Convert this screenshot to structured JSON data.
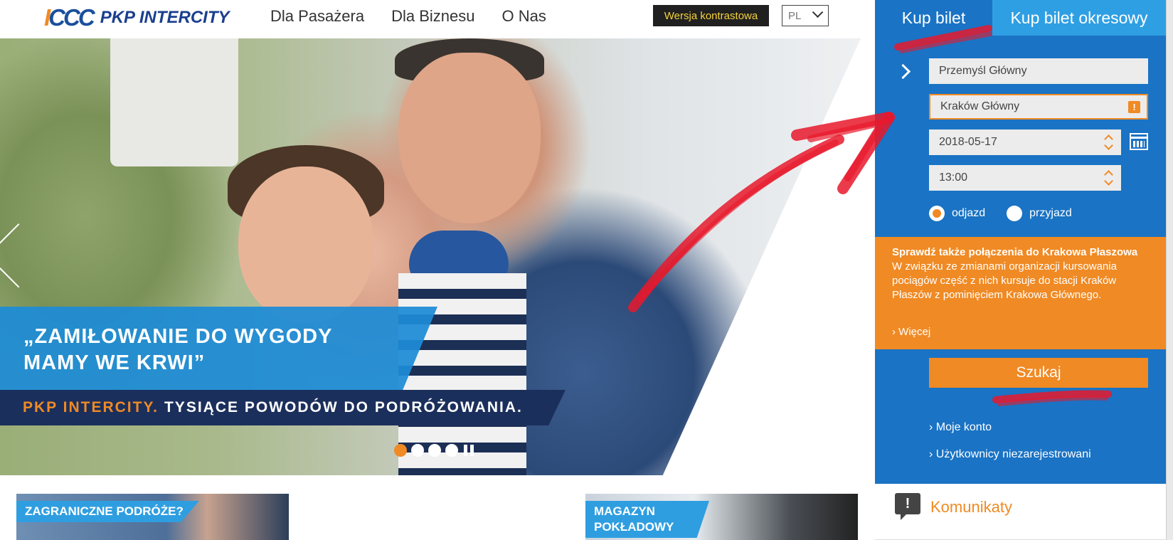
{
  "header": {
    "logo_mark": "IC",
    "logo_text": "PKP INTERCITY",
    "nav": [
      "Dla Pasażera",
      "Dla Biznesu",
      "O Nas"
    ],
    "contrast_label": "Wersja kontrastowa",
    "language": "PL"
  },
  "hero": {
    "quote_line1": "„ZAMIŁOWANIE DO WYGODY",
    "quote_line2": "MAMY WE KRWI”",
    "tagline_brand": "PKP INTERCITY.",
    "tagline_rest": "TYSIĄCE POWODÓW DO PODRÓŻOWANIA.",
    "slides": 5,
    "active_slide": 1
  },
  "tiles": {
    "left_label": "ZAGRANICZNE PODRÓŻE?",
    "right_label_line1": "MAGAZYN",
    "right_label_line2": "POKŁADOWY"
  },
  "booking": {
    "tab_single": "Kup bilet",
    "tab_period": "Kup bilet okresowy",
    "from_station": "Przemyśl Główny",
    "to_station": "Kraków Główny",
    "date": "2018-05-17",
    "time": "13:00",
    "radio_departure": "odjazd",
    "radio_arrival": "przyjazd",
    "selected": "odjazd",
    "notice_title": "Sprawdź także połączenia do Krakowa Płaszowa",
    "notice_body": "W związku ze zmianami organizacji kursowania pociągów część z nich kursuje do stacji Kraków Płaszów z pominięciem Krakowa Głównego.",
    "notice_more": "Więcej",
    "search_label": "Szukaj",
    "link_account": "Moje konto",
    "link_unregistered": "Użytkownicy niezarejestrowani"
  },
  "announcements": {
    "label": "Komunikaty"
  },
  "colors": {
    "brand_orange": "#f08a24",
    "panel_blue": "#1a73c4",
    "tab_blue": "#2f9fe3",
    "navy": "#1b2f5c",
    "annotation_red": "#e8192c"
  }
}
